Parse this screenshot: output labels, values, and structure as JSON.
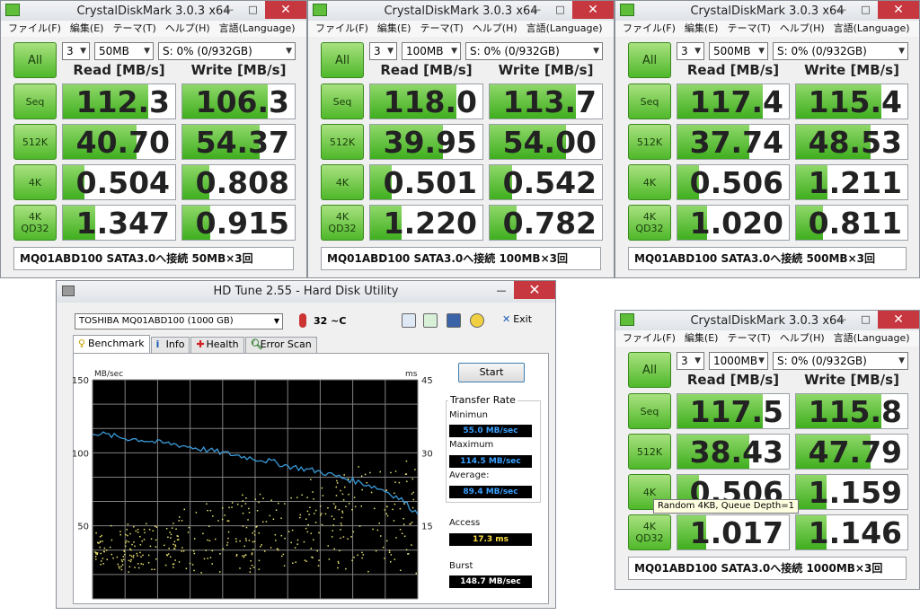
{
  "menu": [
    "ファイル(F)",
    "編集(E)",
    "テーマ(T)",
    "ヘルプ(H)",
    "言語(Language)"
  ],
  "common": {
    "title": "CrystalDiskMark 3.0.3 x64",
    "all_label": "All",
    "read_label": "Read [MB/s]",
    "write_label": "Write [MB/s]",
    "count": "3",
    "drive": "S: 0% (0/932GB)",
    "rows": [
      "Seq",
      "512K",
      "4K",
      "4K\nQD32"
    ],
    "minimize": "—",
    "maximize": "□",
    "close": "✕",
    "accent_green": "#4fb82a"
  },
  "cdm_windows": [
    {
      "size": "50MB",
      "read": [
        "112.3",
        "40.70",
        "0.504",
        "1.347"
      ],
      "write": [
        "106.3",
        "54.37",
        "0.808",
        "0.915"
      ],
      "comment": "MQ01ABD100 SATA3.0へ接続 50MB×3回"
    },
    {
      "size": "100MB",
      "read": [
        "118.0",
        "39.95",
        "0.501",
        "1.220"
      ],
      "write": [
        "113.7",
        "54.00",
        "0.542",
        "0.782"
      ],
      "comment": "MQ01ABD100 SATA3.0へ接続 100MB×3回"
    },
    {
      "size": "500MB",
      "read": [
        "117.4",
        "37.74",
        "0.506",
        "1.020"
      ],
      "write": [
        "115.4",
        "48.53",
        "1.211",
        "0.811"
      ],
      "comment": "MQ01ABD100 SATA3.0へ接続 500MB×3回"
    },
    {
      "size": "1000MB",
      "read": [
        "117.5",
        "38.43",
        "0.506",
        "1.017"
      ],
      "write": [
        "115.8",
        "47.79",
        "1.159",
        "1.146"
      ],
      "comment": "MQ01ABD100 SATA3.0へ接続 1000MB×3回"
    }
  ],
  "tooltip": "Random 4KB, Queue Depth=1",
  "hdtune": {
    "title": "HD Tune 2.55 - Hard Disk Utility",
    "drive": "TOSHIBA MQ01ABD100 (1000 GB)",
    "temperature": "32 ~C",
    "exit_label": "Exit",
    "tabs": [
      "Benchmark",
      "Info",
      "Health",
      "Error Scan"
    ],
    "start_label": "Start",
    "transfer_rate_label": "Transfer Rate",
    "minimum_label": "Minimun",
    "minimum_value": "55.0 MB/sec",
    "maximum_label": "Maximum",
    "maximum_value": "114.5 MB/sec",
    "average_label": "Average:",
    "average_value": "89.4 MB/sec",
    "access_label": "Access",
    "access_value": "17.3 ms",
    "burst_label": "Burst",
    "burst_value": "148.7 MB/sec"
  },
  "chart_data": {
    "type": "line",
    "title": "",
    "xlabel": "",
    "ylabel": "MB/sec",
    "y2label": "ms",
    "ylim": [
      0,
      150
    ],
    "y2lim": [
      0,
      45
    ],
    "yticks": [
      "150",
      "100",
      "50"
    ],
    "y2ticks": [
      "45",
      "30",
      "15"
    ],
    "grid": true,
    "x": [
      0,
      5,
      10,
      15,
      20,
      25,
      30,
      35,
      40,
      45,
      50,
      55,
      60,
      65,
      70,
      75,
      80,
      85,
      90,
      95,
      100
    ],
    "series": [
      {
        "values": [
          114,
          112,
          110,
          109,
          107,
          106,
          104,
          102,
          100,
          98,
          96,
          94,
          91,
          89,
          87,
          84,
          81,
          78,
          74,
          68,
          58
        ],
        "color": "#3a9ad9"
      }
    ],
    "scatter_access_ms_range": [
      5,
      28
    ]
  }
}
